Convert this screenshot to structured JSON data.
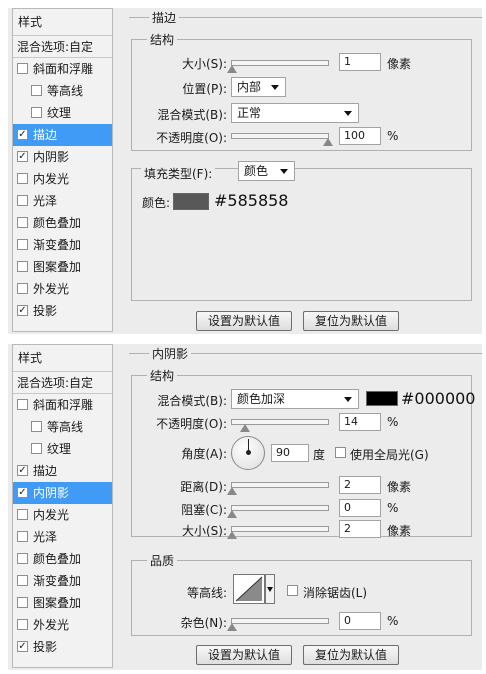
{
  "panel_top": {
    "sidebar": {
      "title": "样式",
      "blend": "混合选项:自定",
      "items": [
        {
          "label": "斜面和浮雕",
          "checked": false,
          "selected": false,
          "sub": false
        },
        {
          "label": "等高线",
          "checked": false,
          "selected": false,
          "sub": true
        },
        {
          "label": "纹理",
          "checked": false,
          "selected": false,
          "sub": true
        },
        {
          "label": "描边",
          "checked": true,
          "selected": true,
          "sub": false
        },
        {
          "label": "内阴影",
          "checked": true,
          "selected": false,
          "sub": false
        },
        {
          "label": "内发光",
          "checked": false,
          "selected": false,
          "sub": false
        },
        {
          "label": "光泽",
          "checked": false,
          "selected": false,
          "sub": false
        },
        {
          "label": "颜色叠加",
          "checked": false,
          "selected": false,
          "sub": false
        },
        {
          "label": "渐变叠加",
          "checked": false,
          "selected": false,
          "sub": false
        },
        {
          "label": "图案叠加",
          "checked": false,
          "selected": false,
          "sub": false
        },
        {
          "label": "外发光",
          "checked": false,
          "selected": false,
          "sub": false
        },
        {
          "label": "投影",
          "checked": true,
          "selected": false,
          "sub": false
        }
      ]
    },
    "section_title": "描边",
    "group_title": "结构",
    "size_label": "大小(S):",
    "size_value": "1",
    "size_unit": "像素",
    "size_level": 0,
    "position_label": "位置(P):",
    "position_value": "内部",
    "blend_label": "混合模式(B):",
    "blend_value": "正常",
    "opacity_label": "不透明度(O):",
    "opacity_value": "100",
    "opacity_unit": "%",
    "opacity_level": 1,
    "fill_type_label": "填充类型(F):",
    "fill_type_value": "颜色",
    "color_label": "颜色:",
    "color_hex_text": "#585858",
    "color_swatch": "#585858",
    "btn_default": "设置为默认值",
    "btn_reset": "复位为默认值"
  },
  "panel_bottom": {
    "sidebar": {
      "title": "样式",
      "blend": "混合选项:自定",
      "items": [
        {
          "label": "斜面和浮雕",
          "checked": false,
          "selected": false,
          "sub": false
        },
        {
          "label": "等高线",
          "checked": false,
          "selected": false,
          "sub": true
        },
        {
          "label": "纹理",
          "checked": false,
          "selected": false,
          "sub": true
        },
        {
          "label": "描边",
          "checked": true,
          "selected": false,
          "sub": false
        },
        {
          "label": "内阴影",
          "checked": true,
          "selected": true,
          "sub": false
        },
        {
          "label": "内发光",
          "checked": false,
          "selected": false,
          "sub": false
        },
        {
          "label": "光泽",
          "checked": false,
          "selected": false,
          "sub": false
        },
        {
          "label": "颜色叠加",
          "checked": false,
          "selected": false,
          "sub": false
        },
        {
          "label": "渐变叠加",
          "checked": false,
          "selected": false,
          "sub": false
        },
        {
          "label": "图案叠加",
          "checked": false,
          "selected": false,
          "sub": false
        },
        {
          "label": "外发光",
          "checked": false,
          "selected": false,
          "sub": false
        },
        {
          "label": "投影",
          "checked": true,
          "selected": false,
          "sub": false
        }
      ]
    },
    "section_title": "内阴影",
    "group_title": "结构",
    "blend_label": "混合模式(B):",
    "blend_value": "颜色加深",
    "color_hex_text": "#000000",
    "color_swatch": "#000000",
    "opacity_label": "不透明度(O):",
    "opacity_value": "14",
    "opacity_unit": "%",
    "opacity_level": 0.14,
    "angle_label": "角度(A):",
    "angle_value": "90",
    "angle_unit": "度",
    "global_light_label": "使用全局光(G)",
    "global_light_checked": false,
    "distance_label": "距离(D):",
    "distance_value": "2",
    "distance_unit": "像素",
    "distance_level": 0,
    "choke_label": "阻塞(C):",
    "choke_value": "0",
    "choke_unit": "%",
    "choke_level": 0,
    "size_label": "大小(S):",
    "size_value": "2",
    "size_unit": "像素",
    "size_level": 0,
    "quality_title": "品质",
    "contour_label": "等高线:",
    "anti_alias_label": "消除锯齿(L)",
    "anti_alias_checked": false,
    "noise_label": "杂色(N):",
    "noise_value": "0",
    "noise_unit": "%",
    "noise_level": 0,
    "btn_default": "设置为默认值",
    "btn_reset": "复位为默认值"
  },
  "colors": {
    "selection": "#3f9bf5",
    "panel_bg": "#ececec"
  },
  "icons": {
    "checkbox": "check-mark",
    "dropdown": "triangle-down",
    "slider_knob": "triangle-up",
    "angle_dial": "circle-dial",
    "contour_preview": "linear-contour"
  }
}
